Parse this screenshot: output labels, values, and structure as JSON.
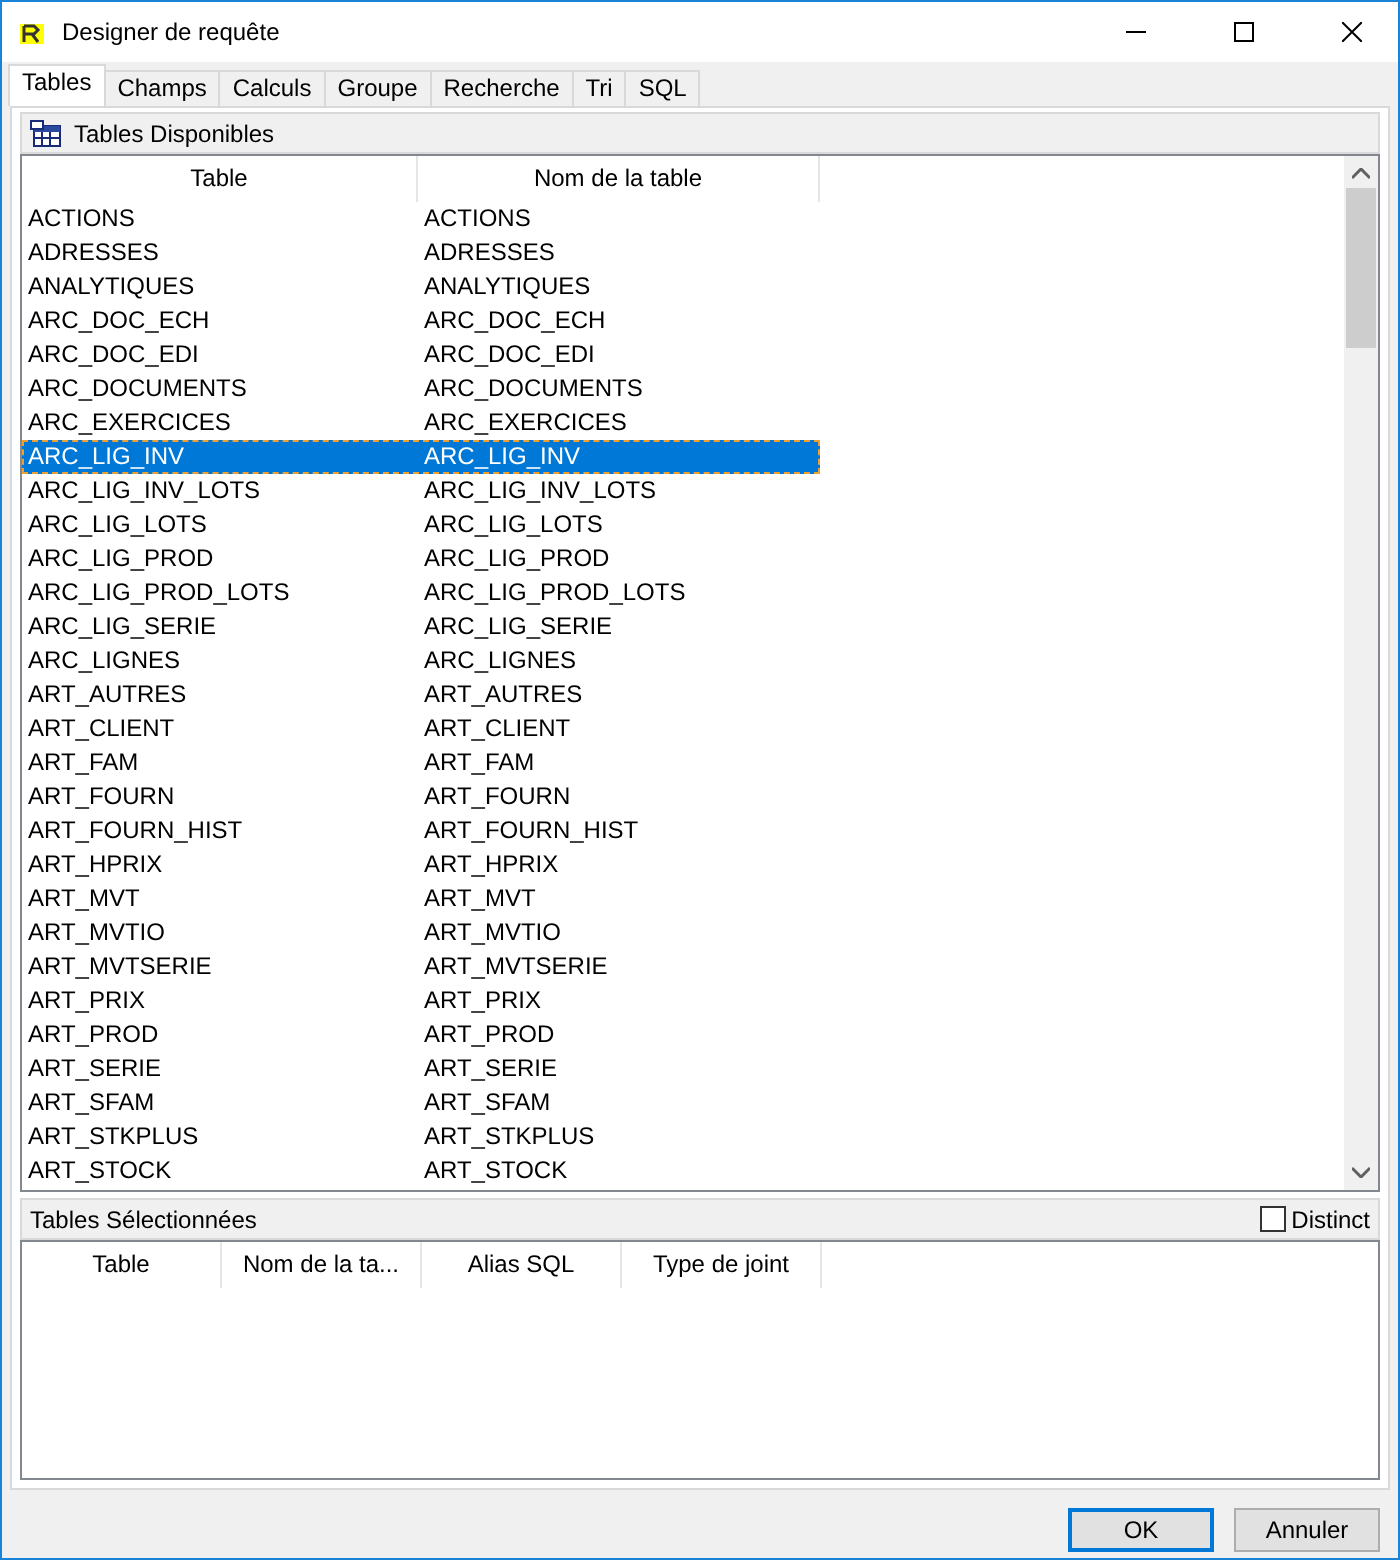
{
  "window": {
    "title": "Designer de requête"
  },
  "tabs": [
    {
      "label": "Tables",
      "selected": true
    },
    {
      "label": "Champs",
      "selected": false
    },
    {
      "label": "Calculs",
      "selected": false
    },
    {
      "label": "Groupe",
      "selected": false
    },
    {
      "label": "Recherche",
      "selected": false
    },
    {
      "label": "Tri",
      "selected": false
    },
    {
      "label": "SQL",
      "selected": false
    }
  ],
  "available": {
    "title": "Tables Disponibles",
    "columns": [
      "Table",
      "Nom de la table"
    ],
    "rows": [
      {
        "table": "ACTIONS",
        "name": "ACTIONS",
        "selected": false
      },
      {
        "table": "ADRESSES",
        "name": "ADRESSES",
        "selected": false
      },
      {
        "table": "ANALYTIQUES",
        "name": "ANALYTIQUES",
        "selected": false
      },
      {
        "table": "ARC_DOC_ECH",
        "name": "ARC_DOC_ECH",
        "selected": false
      },
      {
        "table": "ARC_DOC_EDI",
        "name": "ARC_DOC_EDI",
        "selected": false
      },
      {
        "table": "ARC_DOCUMENTS",
        "name": "ARC_DOCUMENTS",
        "selected": false
      },
      {
        "table": "ARC_EXERCICES",
        "name": "ARC_EXERCICES",
        "selected": false
      },
      {
        "table": "ARC_LIG_INV",
        "name": "ARC_LIG_INV",
        "selected": true
      },
      {
        "table": "ARC_LIG_INV_LOTS",
        "name": "ARC_LIG_INV_LOTS",
        "selected": false
      },
      {
        "table": "ARC_LIG_LOTS",
        "name": "ARC_LIG_LOTS",
        "selected": false
      },
      {
        "table": "ARC_LIG_PROD",
        "name": "ARC_LIG_PROD",
        "selected": false
      },
      {
        "table": "ARC_LIG_PROD_LOTS",
        "name": "ARC_LIG_PROD_LOTS",
        "selected": false
      },
      {
        "table": "ARC_LIG_SERIE",
        "name": "ARC_LIG_SERIE",
        "selected": false
      },
      {
        "table": "ARC_LIGNES",
        "name": "ARC_LIGNES",
        "selected": false
      },
      {
        "table": "ART_AUTRES",
        "name": "ART_AUTRES",
        "selected": false
      },
      {
        "table": "ART_CLIENT",
        "name": "ART_CLIENT",
        "selected": false
      },
      {
        "table": "ART_FAM",
        "name": "ART_FAM",
        "selected": false
      },
      {
        "table": "ART_FOURN",
        "name": "ART_FOURN",
        "selected": false
      },
      {
        "table": "ART_FOURN_HIST",
        "name": "ART_FOURN_HIST",
        "selected": false
      },
      {
        "table": "ART_HPRIX",
        "name": "ART_HPRIX",
        "selected": false
      },
      {
        "table": "ART_MVT",
        "name": "ART_MVT",
        "selected": false
      },
      {
        "table": "ART_MVTIO",
        "name": "ART_MVTIO",
        "selected": false
      },
      {
        "table": "ART_MVTSERIE",
        "name": "ART_MVTSERIE",
        "selected": false
      },
      {
        "table": "ART_PRIX",
        "name": "ART_PRIX",
        "selected": false
      },
      {
        "table": "ART_PROD",
        "name": "ART_PROD",
        "selected": false
      },
      {
        "table": "ART_SERIE",
        "name": "ART_SERIE",
        "selected": false
      },
      {
        "table": "ART_SFAM",
        "name": "ART_SFAM",
        "selected": false
      },
      {
        "table": "ART_STKPLUS",
        "name": "ART_STKPLUS",
        "selected": false
      },
      {
        "table": "ART_STOCK",
        "name": "ART_STOCK",
        "selected": false
      }
    ]
  },
  "selected_tables": {
    "title": "Tables Sélectionnées",
    "distinct": {
      "label": "Distinct",
      "checked": false
    },
    "columns": [
      "Table",
      "Nom de la ta...",
      "Alias SQL",
      "Type de joint"
    ]
  },
  "buttons": [
    {
      "label": "OK",
      "default": true
    },
    {
      "label": "Annuler",
      "default": false
    }
  ]
}
